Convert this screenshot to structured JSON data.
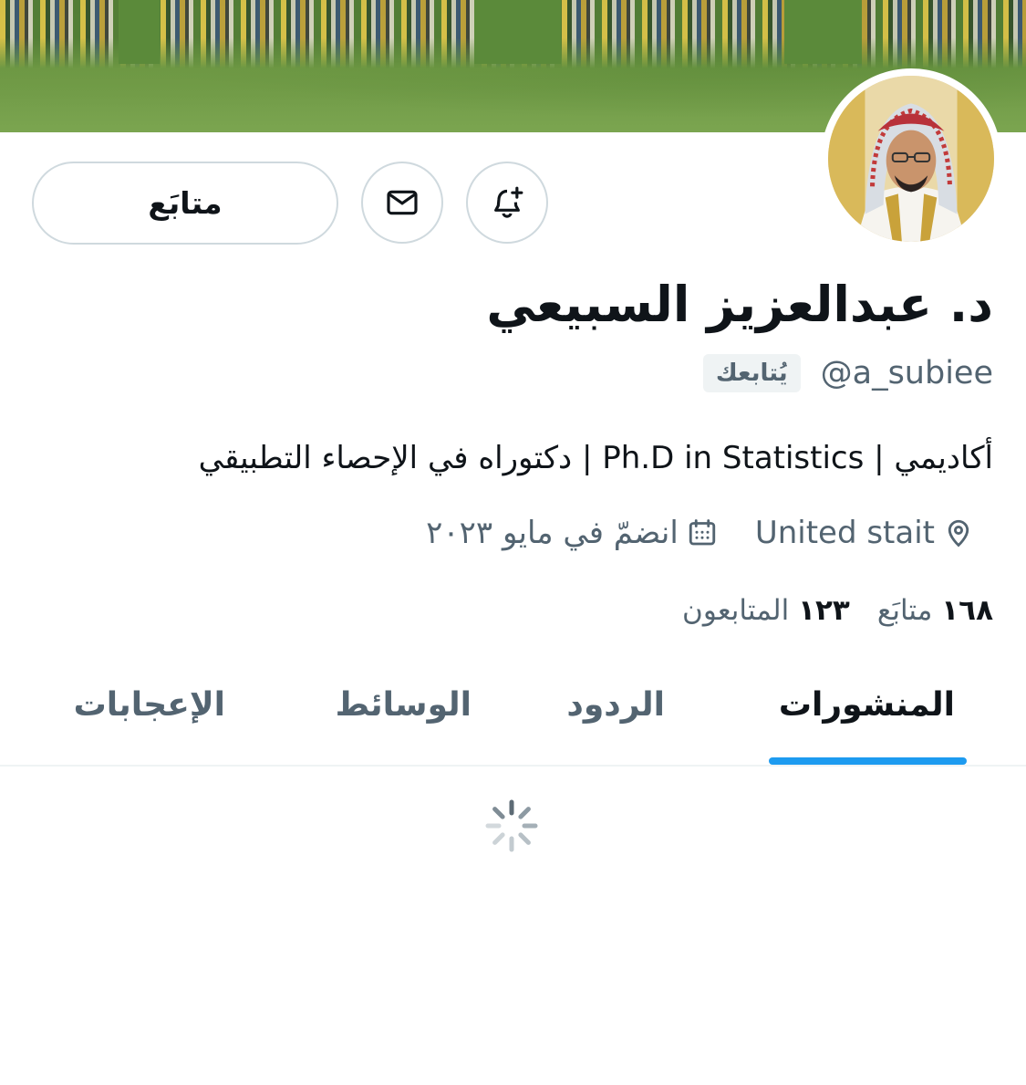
{
  "profile": {
    "name": "د. عبدالعزيز السبيعي",
    "handle": "@a_subiee",
    "follows_you": "يُتابعك",
    "bio": "أكاديمي | Ph.D in Statistics | دكتوراه في الإحصاء التطبيقي",
    "location": "United stait",
    "joined": "انضمّ في مايو ٢٠٢٣",
    "following_count": "١٦٨",
    "following_label": "متابَع",
    "followers_count": "١٢٣",
    "followers_label": "المتابعون"
  },
  "actions": {
    "follow_label": "متابَع",
    "notify_icon": "bell-plus-icon",
    "message_icon": "envelope-icon"
  },
  "tabs": [
    {
      "label": "المنشورات",
      "active": true
    },
    {
      "label": "الردود",
      "active": false
    },
    {
      "label": "الوسائط",
      "active": false
    },
    {
      "label": "الإعجابات",
      "active": false
    }
  ],
  "colors": {
    "accent": "#1d9bf0",
    "secondary_text": "#536471",
    "primary_text": "#0f1419",
    "border": "#cfd9de"
  }
}
